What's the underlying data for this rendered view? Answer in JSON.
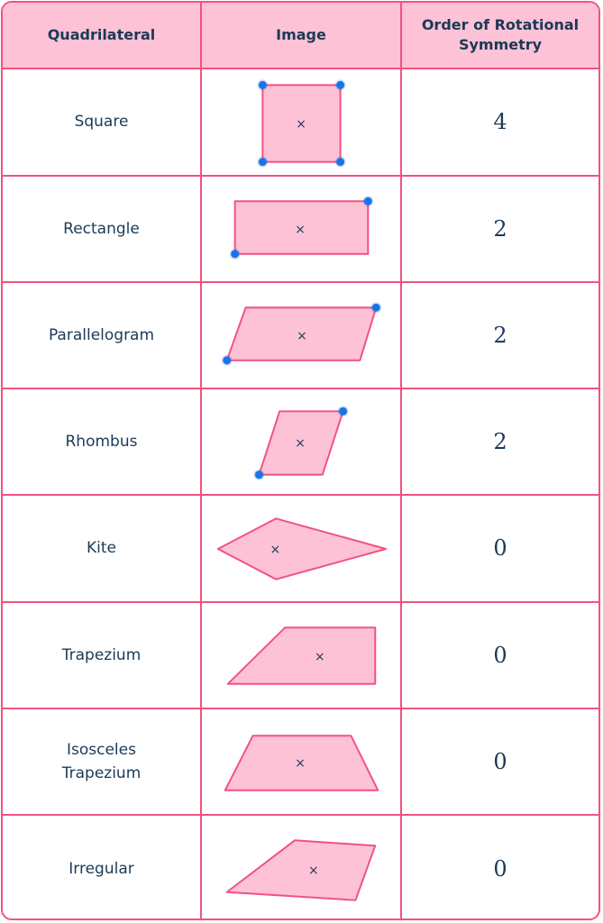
{
  "header": {
    "quadrilateral": "Quadrilateral",
    "image": "Image",
    "order": "Order of Rotational Symmetry"
  },
  "colors": {
    "border": "#f2527f",
    "header_fill": "#fec2d6",
    "shape_fill": "#fec2d6",
    "shape_stroke": "#f2527f",
    "vertex_dot": "#1a73e8",
    "text": "#1b3a57"
  },
  "center_marker": "×",
  "rows": [
    {
      "name": "Square",
      "order": "4",
      "shape": "square",
      "marked_vertices": 4
    },
    {
      "name": "Rectangle",
      "order": "2",
      "shape": "rectangle",
      "marked_vertices": 2
    },
    {
      "name": "Parallelogram",
      "order": "2",
      "shape": "parallelogram",
      "marked_vertices": 2
    },
    {
      "name": "Rhombus",
      "order": "2",
      "shape": "rhombus",
      "marked_vertices": 2
    },
    {
      "name": "Kite",
      "order": "0",
      "shape": "kite",
      "marked_vertices": 0
    },
    {
      "name": "Trapezium",
      "order": "0",
      "shape": "trapezium",
      "marked_vertices": 0
    },
    {
      "name": "Isosceles Trapezium",
      "order": "0",
      "shape": "isosceles-trapezium",
      "marked_vertices": 0
    },
    {
      "name": "Irregular",
      "order": "0",
      "shape": "irregular",
      "marked_vertices": 0
    }
  ]
}
